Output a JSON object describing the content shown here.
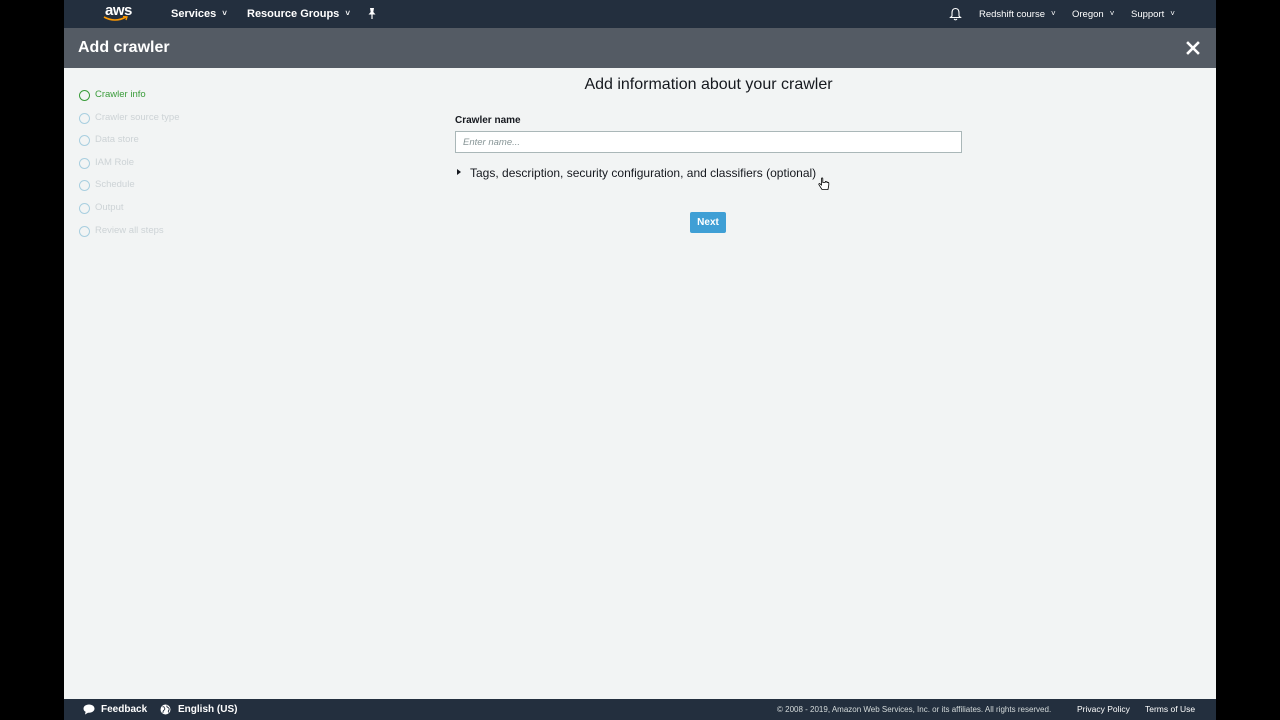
{
  "topnav": {
    "logo_text": "aws",
    "services": "Services",
    "resource_groups": "Resource Groups",
    "account": "Redshift course",
    "region": "Oregon",
    "support": "Support"
  },
  "header": {
    "title": "Add crawler"
  },
  "sidebar": {
    "steps": [
      {
        "label": "Crawler info",
        "active": true
      },
      {
        "label": "Crawler source type",
        "active": false
      },
      {
        "label": "Data store",
        "active": false
      },
      {
        "label": "IAM Role",
        "active": false
      },
      {
        "label": "Schedule",
        "active": false
      },
      {
        "label": "Output",
        "active": false
      },
      {
        "label": "Review all steps",
        "active": false
      }
    ]
  },
  "main": {
    "heading": "Add information about your crawler",
    "crawler_name_label": "Crawler name",
    "crawler_name_value": "",
    "crawler_name_placeholder": "Enter name...",
    "optional_section": "Tags, description, security configuration, and classifiers (optional)",
    "next_label": "Next"
  },
  "footer": {
    "feedback": "Feedback",
    "language": "English (US)",
    "copyright": "© 2008 - 2019, Amazon Web Services, Inc. or its affiliates. All rights reserved.",
    "privacy": "Privacy Policy",
    "terms": "Terms of Use"
  },
  "colors": {
    "nav_bg": "#232f3e",
    "header_bg": "#545b64",
    "page_bg": "#f2f4f4",
    "active_step": "#3a9c3a",
    "primary_button": "#3f9fd5"
  }
}
